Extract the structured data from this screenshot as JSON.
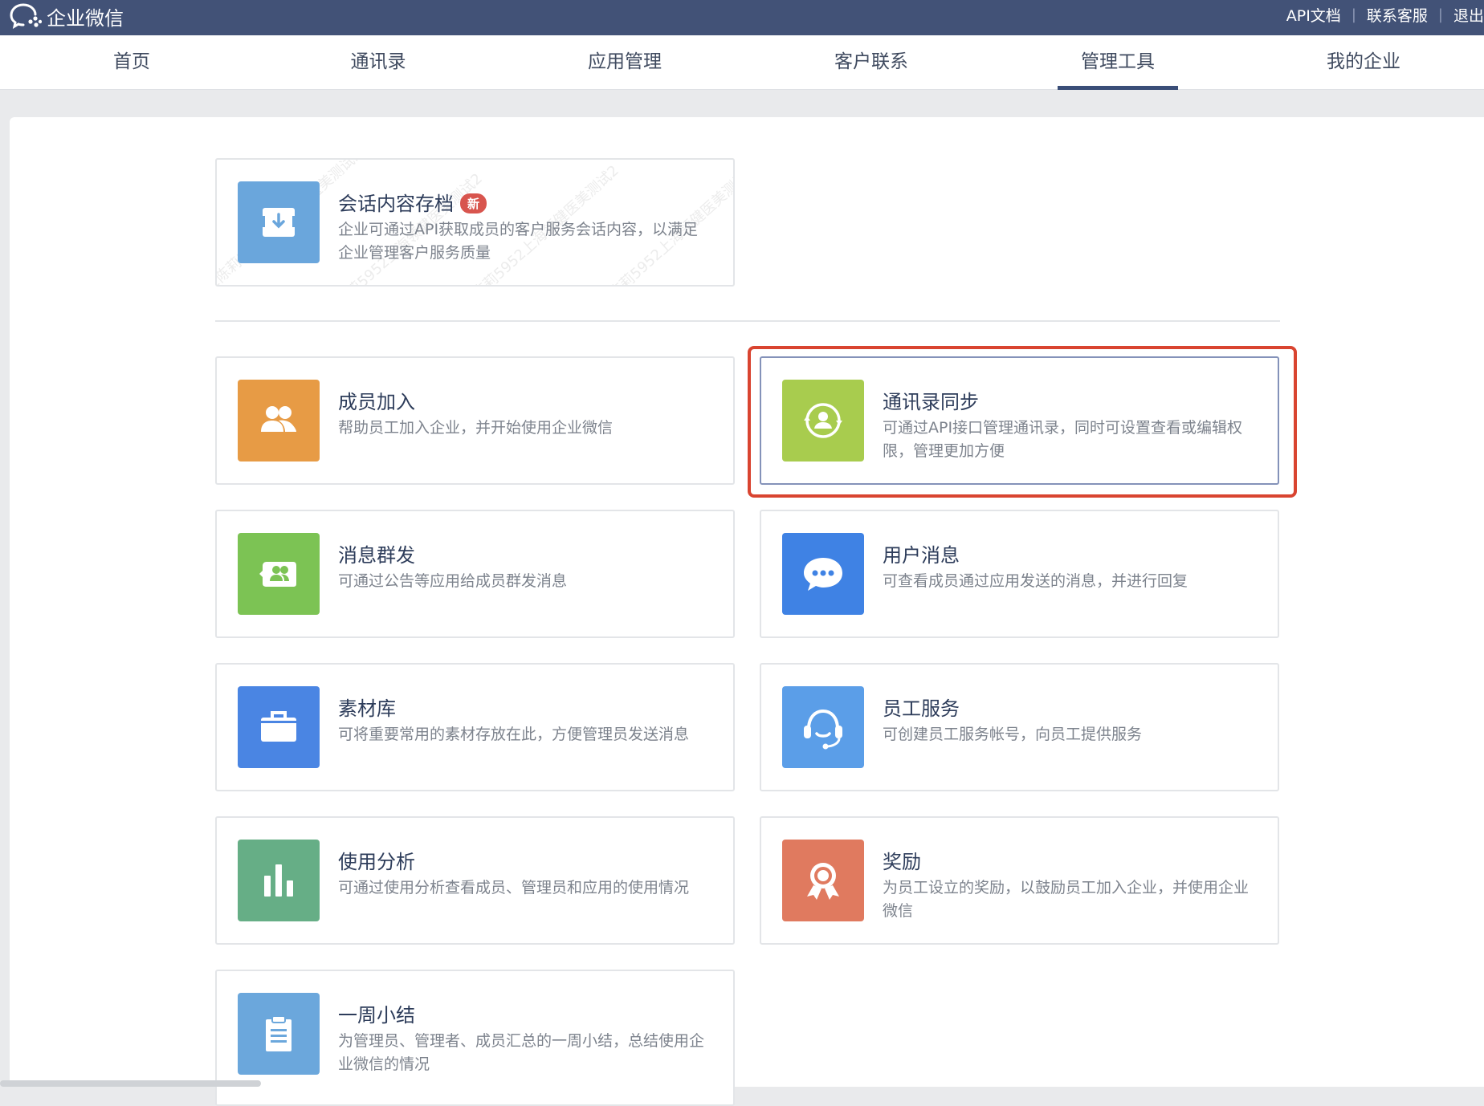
{
  "header": {
    "app_name": "企业微信",
    "links": [
      "API文档",
      "联系客服",
      "退出"
    ],
    "separator": "|"
  },
  "nav": {
    "tabs": [
      {
        "label": "首页"
      },
      {
        "label": "通讯录"
      },
      {
        "label": "应用管理"
      },
      {
        "label": "客户联系"
      },
      {
        "label": "管理工具",
        "active": true
      },
      {
        "label": "我的企业"
      }
    ]
  },
  "featured": {
    "title": "会话内容存档",
    "badge": "新",
    "desc": "企业可通过API获取成员的客户服务会话内容，以满足企业管理客户服务质量",
    "icon": "download-archive-icon",
    "color": "#6aa6dc",
    "watermark": "2陈莉5952上海领健医美测试2"
  },
  "tools": [
    {
      "title": "成员加入",
      "desc": "帮助员工加入企业，并开始使用企业微信",
      "icon": "members-icon",
      "color": "#e79b45"
    },
    {
      "title": "通讯录同步",
      "desc": "可通过API接口管理通讯录，同时可设置查看或编辑权限，管理更加方便",
      "icon": "contact-sync-icon",
      "color": "#a8cc4e",
      "highlighted": true
    },
    {
      "title": "消息群发",
      "desc": "可通过公告等应用给成员群发消息",
      "icon": "broadcast-icon",
      "color": "#7cc354"
    },
    {
      "title": "用户消息",
      "desc": "可查看成员通过应用发送的消息，并进行回复",
      "icon": "chat-bubble-icon",
      "color": "#3f82e4"
    },
    {
      "title": "素材库",
      "desc": "可将重要常用的素材存放在此，方便管理员发送消息",
      "icon": "briefcase-icon",
      "color": "#4a85e3"
    },
    {
      "title": "员工服务",
      "desc": "可创建员工服务帐号，向员工提供服务",
      "icon": "headset-icon",
      "color": "#5b9ee8"
    },
    {
      "title": "使用分析",
      "desc": "可通过使用分析查看成员、管理员和应用的使用情况",
      "icon": "bar-chart-icon",
      "color": "#66ae86"
    },
    {
      "title": "奖励",
      "desc": "为员工设立的奖励，以鼓励员工加入企业，并使用企业微信",
      "icon": "award-icon",
      "color": "#e07a5f"
    },
    {
      "title": "一周小结",
      "desc": "为管理员、管理者、成员汇总的一周小结，总结使用企业微信的情况",
      "icon": "clipboard-icon",
      "color": "#6ba7dc"
    }
  ]
}
